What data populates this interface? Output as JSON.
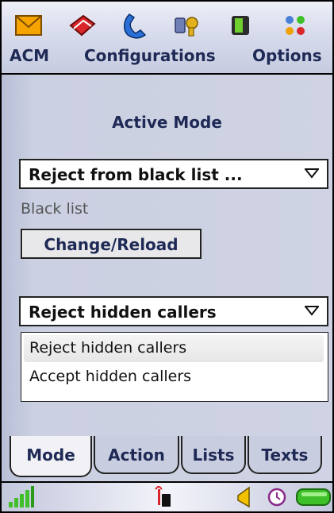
{
  "toolbar_icons": [
    "mail-icon",
    "book-icon",
    "phone-handset-icon",
    "keys-icon",
    "phone-device-icon",
    "apps-grid-icon"
  ],
  "menu": {
    "acm": "ACM",
    "configurations": "Configurations",
    "options": "Options"
  },
  "main": {
    "title": "Active Mode",
    "mode_dropdown_value": "Reject from black list ...",
    "black_list_label": "Black list",
    "change_reload_label": "Change/Reload",
    "hidden_callers_dropdown_value": "Reject hidden callers",
    "hidden_callers_options": [
      "Reject hidden callers",
      "Accept hidden callers"
    ]
  },
  "tabs": [
    {
      "label": "Mode",
      "active": true
    },
    {
      "label": "Action",
      "active": false
    },
    {
      "label": "Lists",
      "active": false
    },
    {
      "label": "Texts",
      "active": false
    }
  ],
  "status_icons": [
    "signal-strength-icon",
    "phone-memory-icon",
    "speaker-icon",
    "clock-icon",
    "battery-icon"
  ],
  "colors": {
    "accent_text": "#1e2a55",
    "panel_bg": "#cfd3e3",
    "battery_green": "#3fbf2a"
  }
}
